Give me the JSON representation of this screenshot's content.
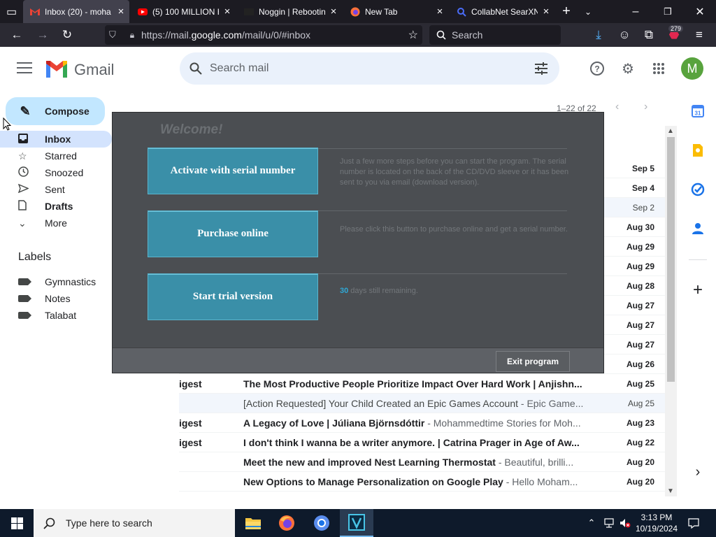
{
  "browser": {
    "tabs": [
      {
        "title": "Inbox (20) - moha",
        "icon": "gmail-icon",
        "active": true
      },
      {
        "title": "(5) 100 MILLION H",
        "icon": "youtube-icon",
        "active": false
      },
      {
        "title": "Noggin | Rebootin",
        "icon": "page-icon",
        "active": false
      },
      {
        "title": "New Tab",
        "icon": "firefox-icon",
        "active": false
      },
      {
        "title": "CollabNet SearXN",
        "icon": "search-icon",
        "active": false
      }
    ],
    "url_prefix": "https://mail.",
    "url_domain": "google.com",
    "url_path": "/mail/u/0/#inbox",
    "search_placeholder": "Search",
    "notif_count": "279"
  },
  "gmail": {
    "brand": "Gmail",
    "search_placeholder": "Search mail",
    "avatar_letter": "M",
    "compose_label": "Compose",
    "nav": [
      {
        "label": "Inbox",
        "icon": "inbox-icon",
        "selected": true,
        "bold": true
      },
      {
        "label": "Starred",
        "icon": "star-icon"
      },
      {
        "label": "Snoozed",
        "icon": "clock-icon"
      },
      {
        "label": "Sent",
        "icon": "send-icon"
      },
      {
        "label": "Drafts",
        "icon": "draft-icon",
        "bold": true
      },
      {
        "label": "More",
        "icon": "chevron-down-icon"
      }
    ],
    "labels_title": "Labels",
    "labels": [
      "Gymnastics",
      "Notes",
      "Talabat"
    ],
    "pager": "1–22 of 22",
    "dates_hidden": [
      "Sep 5",
      "Sep 4",
      "Sep 2",
      "Aug 30",
      "Aug 29",
      "Aug 29",
      "Aug 28",
      "Aug 27",
      "Aug 27",
      "Aug 27",
      "Aug 26"
    ],
    "emails": [
      {
        "sender": "igest",
        "subject": "The Most Productive People Prioritize Impact Over Hard Work | Anjishn...",
        "snippet": "",
        "date": "Aug 25",
        "read": false
      },
      {
        "sender": "",
        "subject": "[Action Requested] Your Child Created an Epic Games Account",
        "snippet": " - Epic Game...",
        "date": "Aug 25",
        "read": true
      },
      {
        "sender": "igest",
        "subject": "A Legacy of Love | Júliana Björnsdóttir",
        "snippet": " - Mohammedtime Stories for Moh...",
        "date": "Aug 23",
        "read": false
      },
      {
        "sender": "igest",
        "subject": "I don't think I wanna be a writer anymore. | Catrina Prager in Age of Aw...",
        "snippet": "",
        "date": "Aug 22",
        "read": false
      },
      {
        "sender": "",
        "subject": "Meet the new and improved Nest Learning Thermostat",
        "snippet": " - Beautiful, brilli...",
        "date": "Aug 20",
        "read": false
      },
      {
        "sender": "",
        "subject": "New Options to Manage Personalization on Google Play",
        "snippet": " - Hello Moham...",
        "date": "Aug 20",
        "read": false
      }
    ]
  },
  "dialog": {
    "title": "Welcome!",
    "btn_activate": "Activate with serial number",
    "desc_activate": "Just a few more steps before you can start the program. The serial number is located on the back of the CD/DVD sleeve or it has been sent to you via email (download version).",
    "btn_purchase": "Purchase online",
    "desc_purchase": "Please click this button to purchase online and get a serial number.",
    "btn_trial": "Start trial version",
    "trial_days": "30",
    "trial_text": " days still remaining.",
    "btn_exit": "Exit program"
  },
  "taskbar": {
    "search_placeholder": "Type here to search",
    "time": "3:13 PM",
    "date": "10/19/2024"
  },
  "colors": {
    "gmail_red": "#ea4335",
    "dialog_button": "#3a8fa8",
    "avatar": "#58a33d"
  }
}
